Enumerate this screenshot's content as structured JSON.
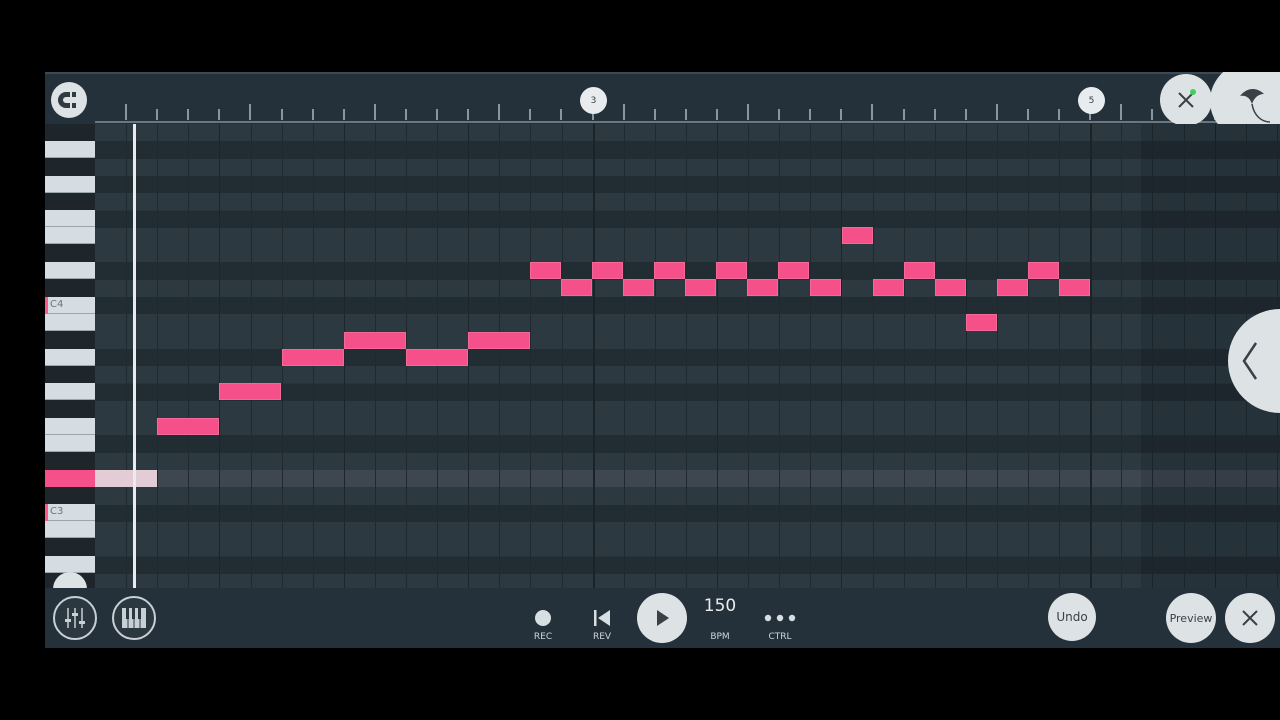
{
  "ruler": {
    "markers": [
      {
        "label": "3"
      },
      {
        "label": "5"
      }
    ]
  },
  "piano": {
    "labels": {
      "c4": "C4",
      "c3": "C3"
    }
  },
  "transport": {
    "rec_label": "REC",
    "rev_label": "REV",
    "bpm_value": "150",
    "bpm_label": "BPM",
    "ctrl_label": "CTRL",
    "undo_label": "Undo",
    "preview_label": "Preview"
  },
  "colors": {
    "note": "#f6508a",
    "background": "#27333b",
    "accent_green": "#3fd15a"
  },
  "icons": {
    "magnet": "magnet-icon",
    "close": "close-icon",
    "logo": "fl-fruit-logo",
    "mixer": "mixer-icon",
    "piano": "piano-icon",
    "record": "record-icon",
    "rewind": "skip-back-icon",
    "play": "play-icon",
    "more": "more-icon",
    "collapse": "chevron-left-icon"
  }
}
